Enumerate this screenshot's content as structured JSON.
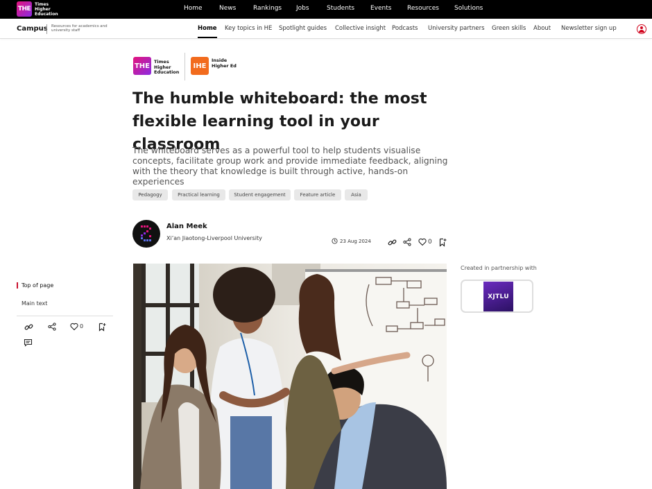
{
  "topbar": {
    "logo_mark": "THE",
    "logo_text": "Times Higher Education",
    "nav": [
      "Home",
      "News",
      "Rankings",
      "Jobs",
      "Students",
      "Events",
      "Resources",
      "Solutions"
    ]
  },
  "subbar": {
    "brand": "Campus",
    "brand_sub": "Resources for academics and university staff",
    "nav": [
      "Home",
      "Key topics in HE",
      "Spotlight guides",
      "Collective insight",
      "Podcasts",
      "University partners",
      "Green skills",
      "About",
      "Newsletter sign up"
    ],
    "active": "Home"
  },
  "partners": {
    "the_mark": "THE",
    "the_text": "Times Higher Education",
    "ihe_mark": "IHE",
    "ihe_text": "Inside Higher Ed"
  },
  "article": {
    "title": "The humble whiteboard: the most flexible learning tool in your classroom",
    "standfirst": "The whiteboard serves as a powerful tool to help students visualise concepts, facilitate group work and provide immediate feedback, aligning with the theory that knowledge is built through active, hands-on experiences",
    "tags": [
      "Pedagogy",
      "Practical learning",
      "Student engagement",
      "Feature article",
      "Asia"
    ],
    "author": "Alan Meek",
    "affiliation": "Xi’an Jiaotong-Liverpool University",
    "date": "23 Aug 2024",
    "likes": "0"
  },
  "toc": {
    "items": [
      "Top of page",
      "Main text"
    ],
    "likes": "0"
  },
  "sidebar": {
    "partner_label": "Created in partnership with",
    "partner_logo": "XJTLU"
  },
  "colors": {
    "accent": "#c8102e",
    "the_gradient_start": "#e4147c",
    "the_gradient_end": "#8b2be2",
    "ihe_orange": "#f26b1d"
  }
}
